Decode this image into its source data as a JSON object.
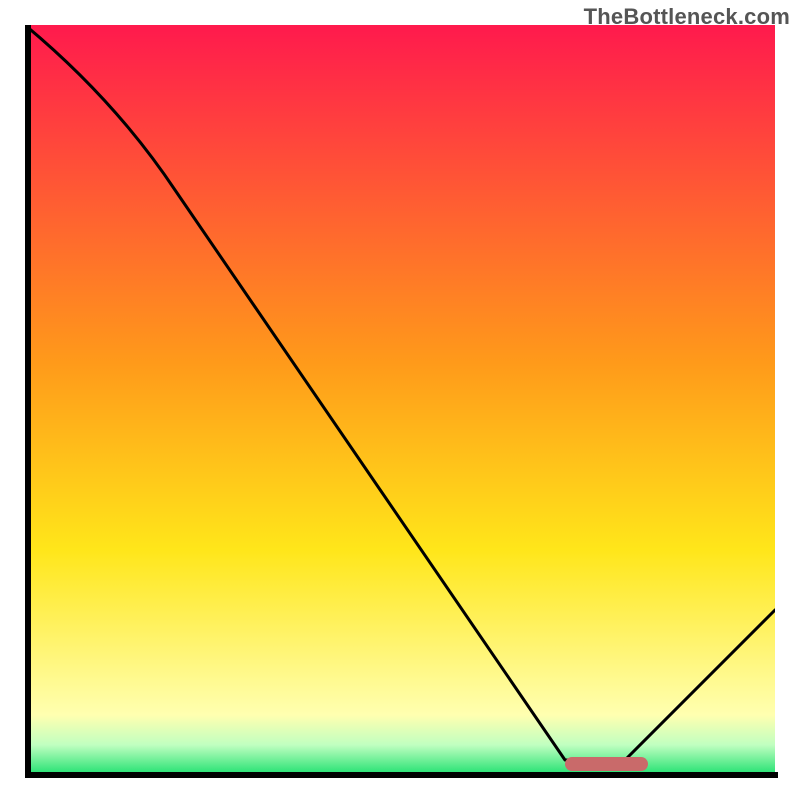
{
  "attribution": "TheBottleneck.com",
  "colors": {
    "axis": "#000000",
    "marker": "#c96a6a",
    "gradient_top": "#ff1a4d",
    "gradient_mid_upper": "#ff9a1a",
    "gradient_mid": "#ffe61a",
    "gradient_mid_lower": "#ffffb0",
    "gradient_bottom": "#20e070"
  },
  "chart_data": {
    "type": "line",
    "title": "",
    "xlabel": "",
    "ylabel": "",
    "y_meaning": "bottleneck severity (100 = worst at top, 0 = optimal at bottom)",
    "x_meaning": "relative hardware configuration (0–100)",
    "xlim": [
      0,
      100
    ],
    "ylim": [
      0,
      100
    ],
    "grid": false,
    "legend": false,
    "series": [
      {
        "name": "bottleneck-curve",
        "x": [
          0,
          20,
          72,
          80,
          100
        ],
        "values": [
          100,
          78,
          2,
          2,
          22
        ]
      }
    ],
    "optimal_range_x": [
      72,
      83
    ],
    "gradient_stops_pct": [
      0,
      45,
      70,
      92,
      96,
      100
    ]
  }
}
